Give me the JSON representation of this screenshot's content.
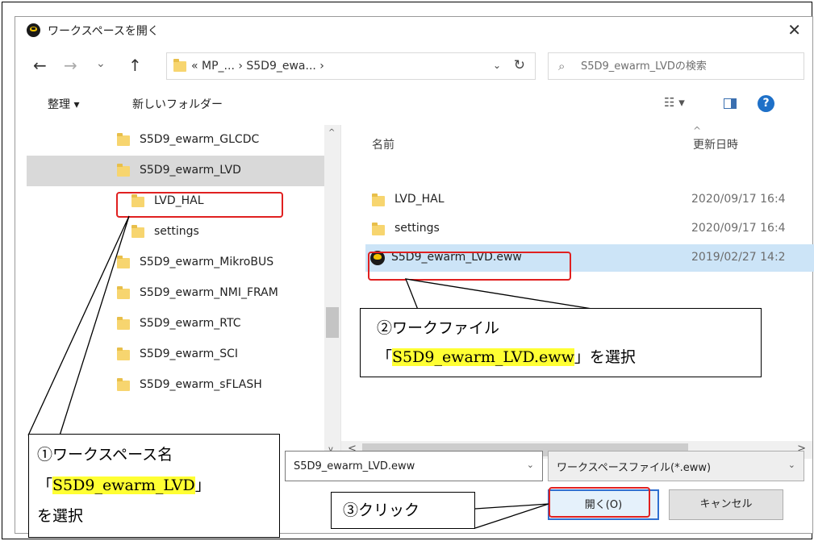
{
  "dialog": {
    "title": "ワークスペースを開く",
    "close_glyph": "✕"
  },
  "nav": {
    "back_glyph": "←",
    "forward_glyph": "→",
    "recent_glyph": "⌄",
    "up_glyph": "↑",
    "address_path": "« MP_... › S5D9_ewa... ›",
    "address_dropdown_glyph": "⌄",
    "refresh_glyph": "↻",
    "search_placeholder": "S5D9_ewarm_LVDの検索",
    "search_glyph": "⌕"
  },
  "toolbar": {
    "organize_label": "整理 ▾",
    "new_folder_label": "新しいフォルダー",
    "view_glyph": "☷ ▾",
    "help_glyph": "?"
  },
  "tree": {
    "items": [
      {
        "label": "S5D9_ewarm_GLCDC",
        "icon": "folder-icon"
      },
      {
        "label": "S5D9_ewarm_LVD",
        "icon": "folder-icon",
        "selected": true
      },
      {
        "label": "LVD_HAL",
        "icon": "folder-icon"
      },
      {
        "label": "settings",
        "icon": "folder-icon"
      },
      {
        "label": "S5D9_ewarm_MikroBUS",
        "icon": "folder-icon"
      },
      {
        "label": "S5D9_ewarm_NMI_FRAM",
        "icon": "folder-icon"
      },
      {
        "label": "S5D9_ewarm_RTC",
        "icon": "folder-icon"
      },
      {
        "label": "S5D9_ewarm_SCI",
        "icon": "folder-icon"
      },
      {
        "label": "S5D9_ewarm_sFLASH",
        "icon": "folder-icon"
      }
    ],
    "scroll_up_glyph": "^",
    "scroll_down_glyph": "v"
  },
  "list": {
    "col_name": "名前",
    "col_date": "更新日時",
    "sort_glyph": "^",
    "rows": [
      {
        "name": "LVD_HAL",
        "date": "2020/09/17 16:4",
        "icon": "folder-icon"
      },
      {
        "name": "settings",
        "date": "2020/09/17 16:4",
        "icon": "folder-icon"
      },
      {
        "name": "S5D9_ewarm_LVD.eww",
        "date": "2019/02/27 14:2",
        "icon": "workspace-file-icon",
        "selected": true
      }
    ],
    "hscroll_left_glyph": "<",
    "hscroll_right_glyph": ">"
  },
  "bottom": {
    "filename_value": "S5D9_ewarm_LVD.eww",
    "filename_dropdown_glyph": "⌄",
    "filter_value": "ワークスペースファイル(*.eww)",
    "filter_dropdown_glyph": "⌄",
    "open_button": "開く(O)",
    "cancel_button": "キャンセル"
  },
  "annotations": {
    "callout1_line1": "①ワークスペース名",
    "callout1_open": "「",
    "callout1_highlight": "S5D9_ewarm_LVD",
    "callout1_close": "」",
    "callout1_line3": "を選択",
    "callout2_line1": "②ワークファイル",
    "callout2_open": "「",
    "callout2_highlight": "S5D9_ewarm_LVD.eww",
    "callout2_close": "」を選択",
    "callout3_text": "③クリック",
    "highlight_color": "#ffff33",
    "marker_color": "#e02020"
  }
}
